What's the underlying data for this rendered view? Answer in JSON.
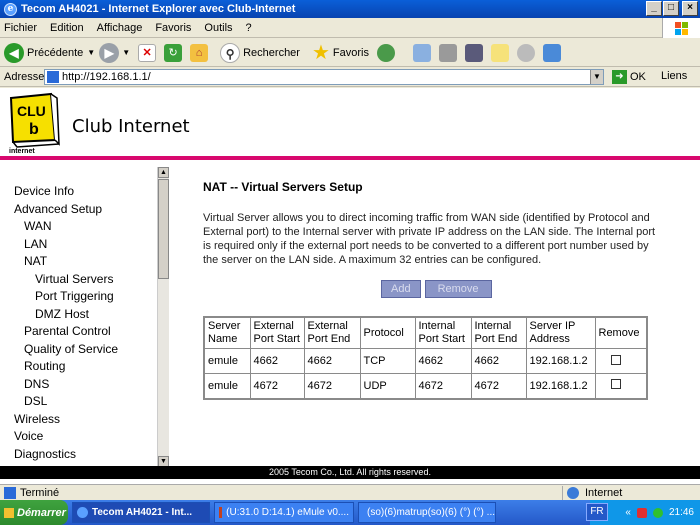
{
  "window": {
    "title": "Tecom AH4021 - Internet Explorer avec Club-Internet",
    "ie_glyph": "e"
  },
  "menu": [
    "Fichier",
    "Edition",
    "Affichage",
    "Favoris",
    "Outils",
    "?"
  ],
  "toolbar": {
    "back_label": "Précédente",
    "search_label": "Rechercher",
    "favorites_label": "Favoris"
  },
  "address": {
    "label": "Adresse",
    "url": "http://192.168.1.1/",
    "go_label": "OK",
    "links_label": "Liens"
  },
  "brand": {
    "name": "Club Internet",
    "logo_text_1": "CLU",
    "logo_text_2": "b",
    "logo_tag": "internet"
  },
  "sidebar": {
    "items": [
      {
        "label": "Device Info",
        "level": 0
      },
      {
        "label": "Advanced Setup",
        "level": 0
      },
      {
        "label": "WAN",
        "level": 1
      },
      {
        "label": "LAN",
        "level": 1
      },
      {
        "label": "NAT",
        "level": 1
      },
      {
        "label": "Virtual Servers",
        "level": 2
      },
      {
        "label": "Port Triggering",
        "level": 2
      },
      {
        "label": "DMZ Host",
        "level": 2
      },
      {
        "label": "Parental Control",
        "level": 1
      },
      {
        "label": "Quality of Service",
        "level": 1
      },
      {
        "label": "Routing",
        "level": 1
      },
      {
        "label": "DNS",
        "level": 1
      },
      {
        "label": "DSL",
        "level": 1
      },
      {
        "label": "Wireless",
        "level": 0
      },
      {
        "label": "Voice",
        "level": 0
      },
      {
        "label": "Diagnostics",
        "level": 0
      }
    ]
  },
  "main": {
    "title": "NAT -- Virtual Servers Setup",
    "description": "Virtual Server allows you to direct incoming traffic from WAN side (identified by Protocol and External port) to the Internal server with private IP address on the LAN side. The Internal port is required only if the external port needs to be converted to a different port number used by the server on the LAN side. A maximum 32 entries can be configured.",
    "add_label": "Add",
    "remove_label": "Remove",
    "table": {
      "headers": [
        "Server Name",
        "External Port Start",
        "External Port End",
        "Protocol",
        "Internal Port Start",
        "Internal Port End",
        "Server IP Address",
        "Remove"
      ],
      "rows": [
        [
          "emule",
          "4662",
          "4662",
          "TCP",
          "4662",
          "4662",
          "192.168.1.2"
        ],
        [
          "emule",
          "4672",
          "4672",
          "UDP",
          "4672",
          "4672",
          "192.168.1.2"
        ]
      ]
    },
    "footer": "2005 Tecom Co., Ltd. All rights reserved."
  },
  "status": {
    "left": "Terminé",
    "zone": "Internet"
  },
  "taskbar": {
    "start": "Démarrer",
    "tasks": [
      "Tecom AH4021 - Int...",
      "(U:31.0 D:14.1) eMule v0....",
      "(so)(6)matrup(so)(6) (°) (°) ..."
    ],
    "lang": "FR",
    "time": "21:46"
  }
}
